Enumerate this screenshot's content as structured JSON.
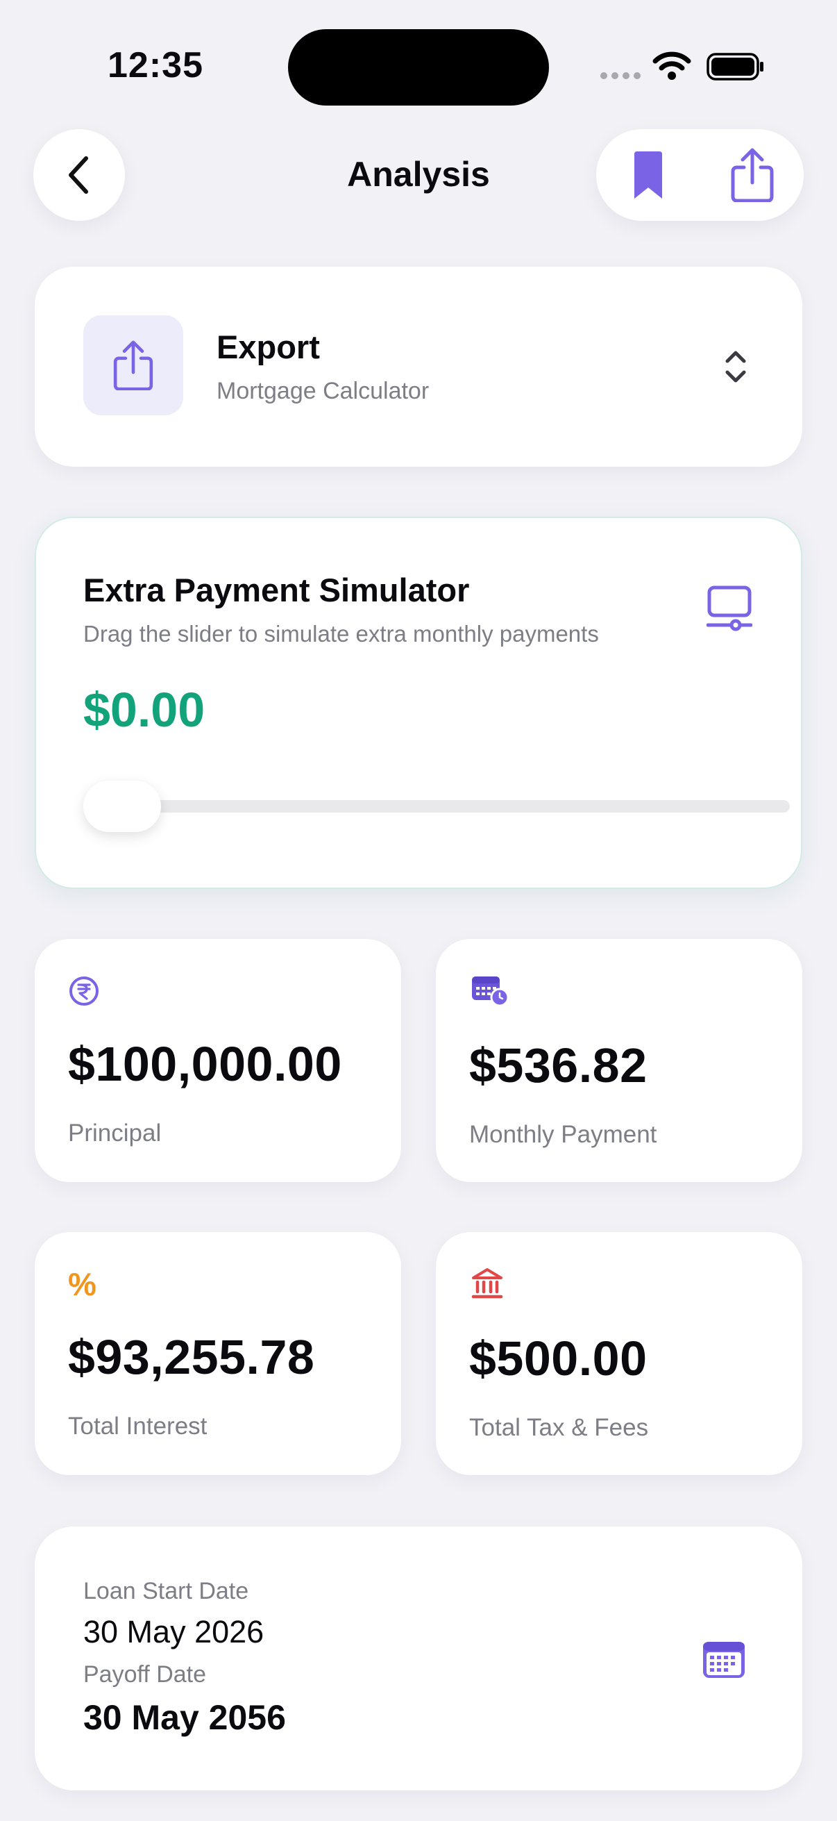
{
  "status_bar": {
    "time": "12:35"
  },
  "header": {
    "title": "Analysis"
  },
  "export_card": {
    "title": "Export",
    "subtitle": "Mortgage Calculator"
  },
  "simulator": {
    "title": "Extra Payment Simulator",
    "subtitle": "Drag the slider to simulate extra monthly payments",
    "amount": "$0.00",
    "slider_fraction": 0
  },
  "stats": {
    "principal": {
      "value": "$100,000.00",
      "label": "Principal",
      "icon": "rupee-icon"
    },
    "monthly": {
      "value": "$536.82",
      "label": "Monthly Payment",
      "icon": "calendar-clock-icon"
    },
    "interest": {
      "value": "$93,255.78",
      "label": "Total Interest",
      "icon": "percent-icon",
      "icon_glyph": "%"
    },
    "tax": {
      "value": "$500.00",
      "label": "Total Tax & Fees",
      "icon": "bank-icon"
    }
  },
  "dates": {
    "start_label": "Loan Start Date",
    "start_value": "30 May 2026",
    "payoff_label": "Payoff Date",
    "payoff_value": "30 May 2056"
  },
  "colors": {
    "accent": "#7b63e6",
    "green": "#12a37a",
    "orange": "#f0961e",
    "red": "#e04848"
  }
}
